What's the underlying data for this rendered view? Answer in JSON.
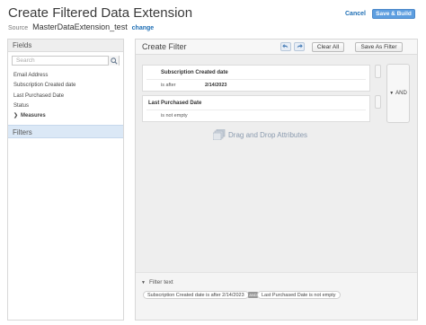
{
  "header": {
    "title": "Create Filtered Data Extension",
    "source_label": "Source",
    "source_value": "MasterDataExtension_test",
    "change_link": "change",
    "cancel_label": "Cancel",
    "save_build_label": "Save & Build"
  },
  "left_panel": {
    "title": "Fields",
    "search_placeholder": "Search",
    "fields": [
      "Email Address",
      "Subscription Created date",
      "Last Purchased Date",
      "Status"
    ],
    "group_label": "Measures",
    "filters_tab": "Filters"
  },
  "right_panel": {
    "title": "Create Filter",
    "clear_all_label": "Clear All",
    "save_as_filter_label": "Save As Filter",
    "conditions": [
      {
        "field": "Subscription Created date",
        "operator": "is after",
        "value": "2/14/2023"
      },
      {
        "field": "Last Purchased Date",
        "operator": "is not empty",
        "value": ""
      }
    ],
    "logic_operator": "AND",
    "drag_hint": "Drag and Drop Attributes",
    "filter_text_label": "Filter text",
    "filter_text_pills": [
      "Subscription Created date is after 2/14/2023",
      "Last Purchased Date is not empty"
    ],
    "filter_text_connector": "AND"
  },
  "colors": {
    "accent_blue": "#5d9ee0",
    "link_blue": "#1f6fb5",
    "selected_tab": "#dbe8f6"
  }
}
